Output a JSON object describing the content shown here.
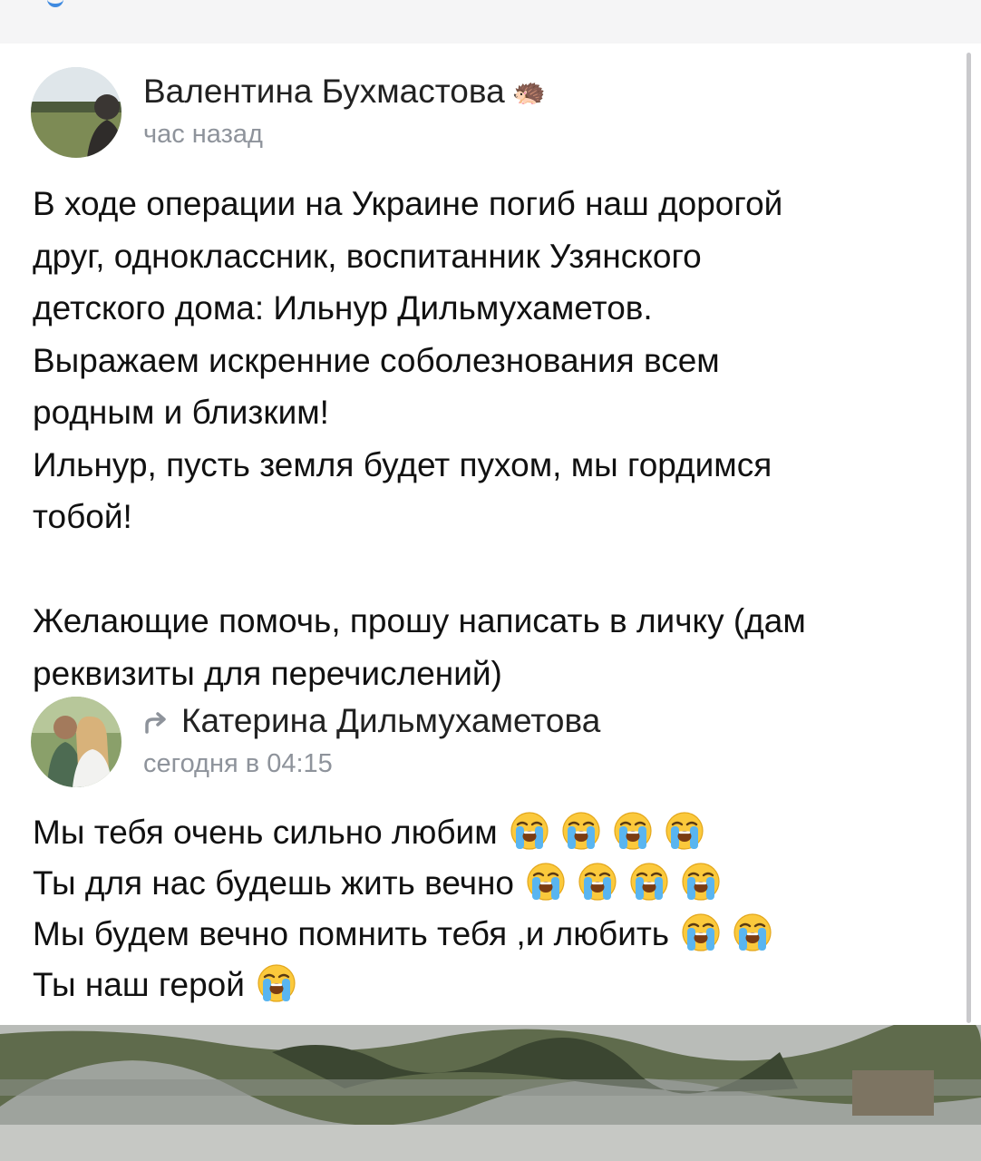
{
  "post": {
    "author": "Валентина Бухмастова",
    "status_icon": "hedgehog-icon",
    "time": "час назад",
    "lines": [
      "В ходе операции на Украине погиб наш дорогой",
      "друг, одноклассник, воспитанник Узянского",
      "детского дома: Ильнур Дильмухаметов.",
      "Выражаем искренние соболезнования всем",
      "родным и близким!",
      "Ильнур, пусть земля будет пухом, мы гордимся",
      "тобой!",
      "",
      "Желающие помочь, прошу написать в личку (дам",
      "реквизиты для перечислений)"
    ]
  },
  "repost": {
    "icon": "repost-arrow-icon",
    "author": "Катерина Дильмухаметова",
    "time": "сегодня в 04:15",
    "lines": [
      {
        "text": "Мы тебя очень сильно любим",
        "emoji_count": 4
      },
      {
        "text": "Ты для нас будешь жить вечно",
        "emoji_count": 4
      },
      {
        "text": "Мы будем вечно помнить тебя ,и любить",
        "emoji_count": 2
      },
      {
        "text": "Ты наш герой",
        "emoji_count": 1
      }
    ],
    "emoji": "loudly-crying-face-icon"
  },
  "photo": {
    "icon": "attached-photo-camouflage"
  }
}
